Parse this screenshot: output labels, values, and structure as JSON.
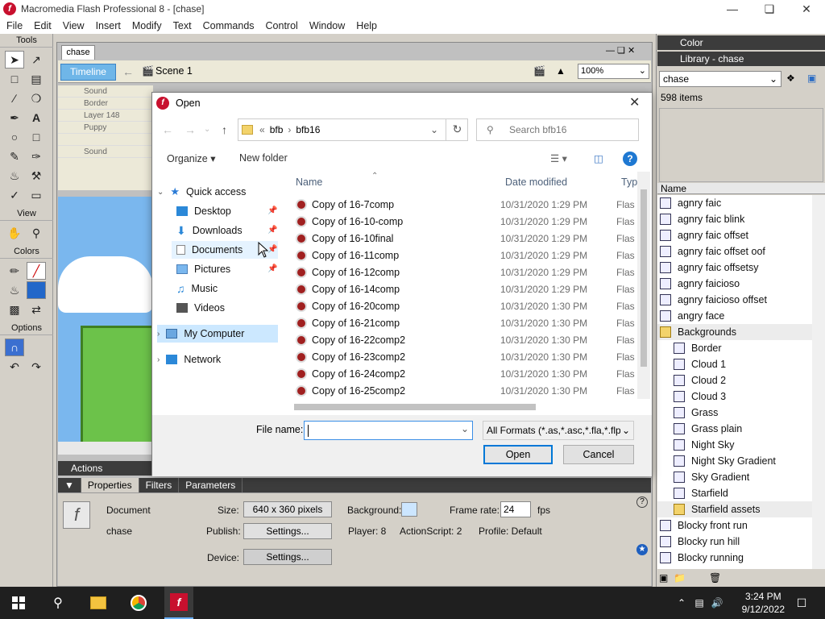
{
  "window": {
    "title": "Macromedia Flash Professional 8 - [chase]",
    "logo_letter": "f"
  },
  "menu": [
    "File",
    "Edit",
    "View",
    "Insert",
    "Modify",
    "Text",
    "Commands",
    "Control",
    "Window",
    "Help"
  ],
  "tools": {
    "title": "Tools",
    "view_label": "View",
    "colors_label": "Colors",
    "options_label": "Options"
  },
  "document": {
    "tab": "chase",
    "timeline_button": "Timeline",
    "scene": "Scene 1",
    "zoom": "100%",
    "layers": [
      "Sound",
      "Border",
      "Layer 148",
      "Puppy",
      "",
      "Sound"
    ]
  },
  "panels": {
    "actions": "Actions",
    "properties_tab": "Properties",
    "filters_tab": "Filters",
    "parameters_tab": "Parameters"
  },
  "properties": {
    "doc_type": "Document",
    "doc_name": "chase",
    "size_label": "Size:",
    "size_value": "640 x 360 pixels",
    "background_label": "Background:",
    "framerate_label": "Frame rate:",
    "framerate_value": "24",
    "fps": "fps",
    "publish_label": "Publish:",
    "settings_label": "Settings...",
    "player_label": "Player: 8",
    "actionscript_label": "ActionScript: 2",
    "profile_label": "Profile:  Default",
    "device_label": "Device:",
    "device_settings": "Settings..."
  },
  "right_panel": {
    "color_title": "Color",
    "library_title": "Library - chase",
    "library_select": "chase",
    "item_count": "598 items",
    "name_header": "Name",
    "items": [
      {
        "label": "agnry faic",
        "type": "item"
      },
      {
        "label": "agnry faic blink",
        "type": "item"
      },
      {
        "label": "agnry faic offset",
        "type": "item"
      },
      {
        "label": "agnry faic offset oof",
        "type": "item"
      },
      {
        "label": "agnry faic offsetsy",
        "type": "item"
      },
      {
        "label": "agnry faicioso",
        "type": "item"
      },
      {
        "label": "agnry faicioso offset",
        "type": "item"
      },
      {
        "label": "angry face",
        "type": "item"
      },
      {
        "label": "Backgrounds",
        "type": "folder-open"
      },
      {
        "label": "Border",
        "type": "sub"
      },
      {
        "label": "Cloud 1",
        "type": "sub"
      },
      {
        "label": "Cloud 2",
        "type": "sub"
      },
      {
        "label": "Cloud 3",
        "type": "sub"
      },
      {
        "label": "Grass",
        "type": "sub"
      },
      {
        "label": "Grass plain",
        "type": "sub"
      },
      {
        "label": "Night Sky",
        "type": "sub"
      },
      {
        "label": "Night Sky Gradient",
        "type": "sub"
      },
      {
        "label": "Sky Gradient",
        "type": "sub"
      },
      {
        "label": "Starfield",
        "type": "sub"
      },
      {
        "label": "Starfield assets",
        "type": "subfolder"
      },
      {
        "label": "Blocky front run",
        "type": "item"
      },
      {
        "label": "Blocky run hill",
        "type": "item"
      },
      {
        "label": "Blocky running",
        "type": "item"
      }
    ]
  },
  "dialog": {
    "title": "Open",
    "breadcrumb_prefix": "«",
    "breadcrumb": [
      "bfb",
      "bfb16"
    ],
    "search_placeholder": "Search bfb16",
    "organize": "Organize ▾",
    "new_folder": "New folder",
    "nav": {
      "quick_access": "Quick access",
      "desktop": "Desktop",
      "downloads": "Downloads",
      "documents": "Documents",
      "pictures": "Pictures",
      "music": "Music",
      "videos": "Videos",
      "my_computer": "My Computer",
      "network": "Network"
    },
    "columns": {
      "name": "Name",
      "date": "Date modified",
      "type": "Typ"
    },
    "files": [
      {
        "name": "Copy of 16-7comp",
        "date": "10/31/2020 1:29 PM",
        "type": "Flas"
      },
      {
        "name": "Copy of 16-10-comp",
        "date": "10/31/2020 1:29 PM",
        "type": "Flas"
      },
      {
        "name": "Copy of 16-10final",
        "date": "10/31/2020 1:29 PM",
        "type": "Flas"
      },
      {
        "name": "Copy of 16-11comp",
        "date": "10/31/2020 1:29 PM",
        "type": "Flas"
      },
      {
        "name": "Copy of 16-12comp",
        "date": "10/31/2020 1:29 PM",
        "type": "Flas"
      },
      {
        "name": "Copy of 16-14comp",
        "date": "10/31/2020 1:29 PM",
        "type": "Flas"
      },
      {
        "name": "Copy of 16-20comp",
        "date": "10/31/2020 1:30 PM",
        "type": "Flas"
      },
      {
        "name": "Copy of 16-21comp",
        "date": "10/31/2020 1:30 PM",
        "type": "Flas"
      },
      {
        "name": "Copy of 16-22comp2",
        "date": "10/31/2020 1:30 PM",
        "type": "Flas"
      },
      {
        "name": "Copy of 16-23comp2",
        "date": "10/31/2020 1:30 PM",
        "type": "Flas"
      },
      {
        "name": "Copy of 16-24comp2",
        "date": "10/31/2020 1:30 PM",
        "type": "Flas"
      },
      {
        "name": "Copy of 16-25comp2",
        "date": "10/31/2020 1:30 PM",
        "type": "Flas"
      }
    ],
    "filename_label": "File name:",
    "filename_value": "",
    "format": "All Formats (*.as,*.asc,*.fla,*.flp,",
    "open_button": "Open",
    "cancel_button": "Cancel"
  },
  "taskbar": {
    "time": "3:24 PM",
    "date": "9/12/2022"
  }
}
